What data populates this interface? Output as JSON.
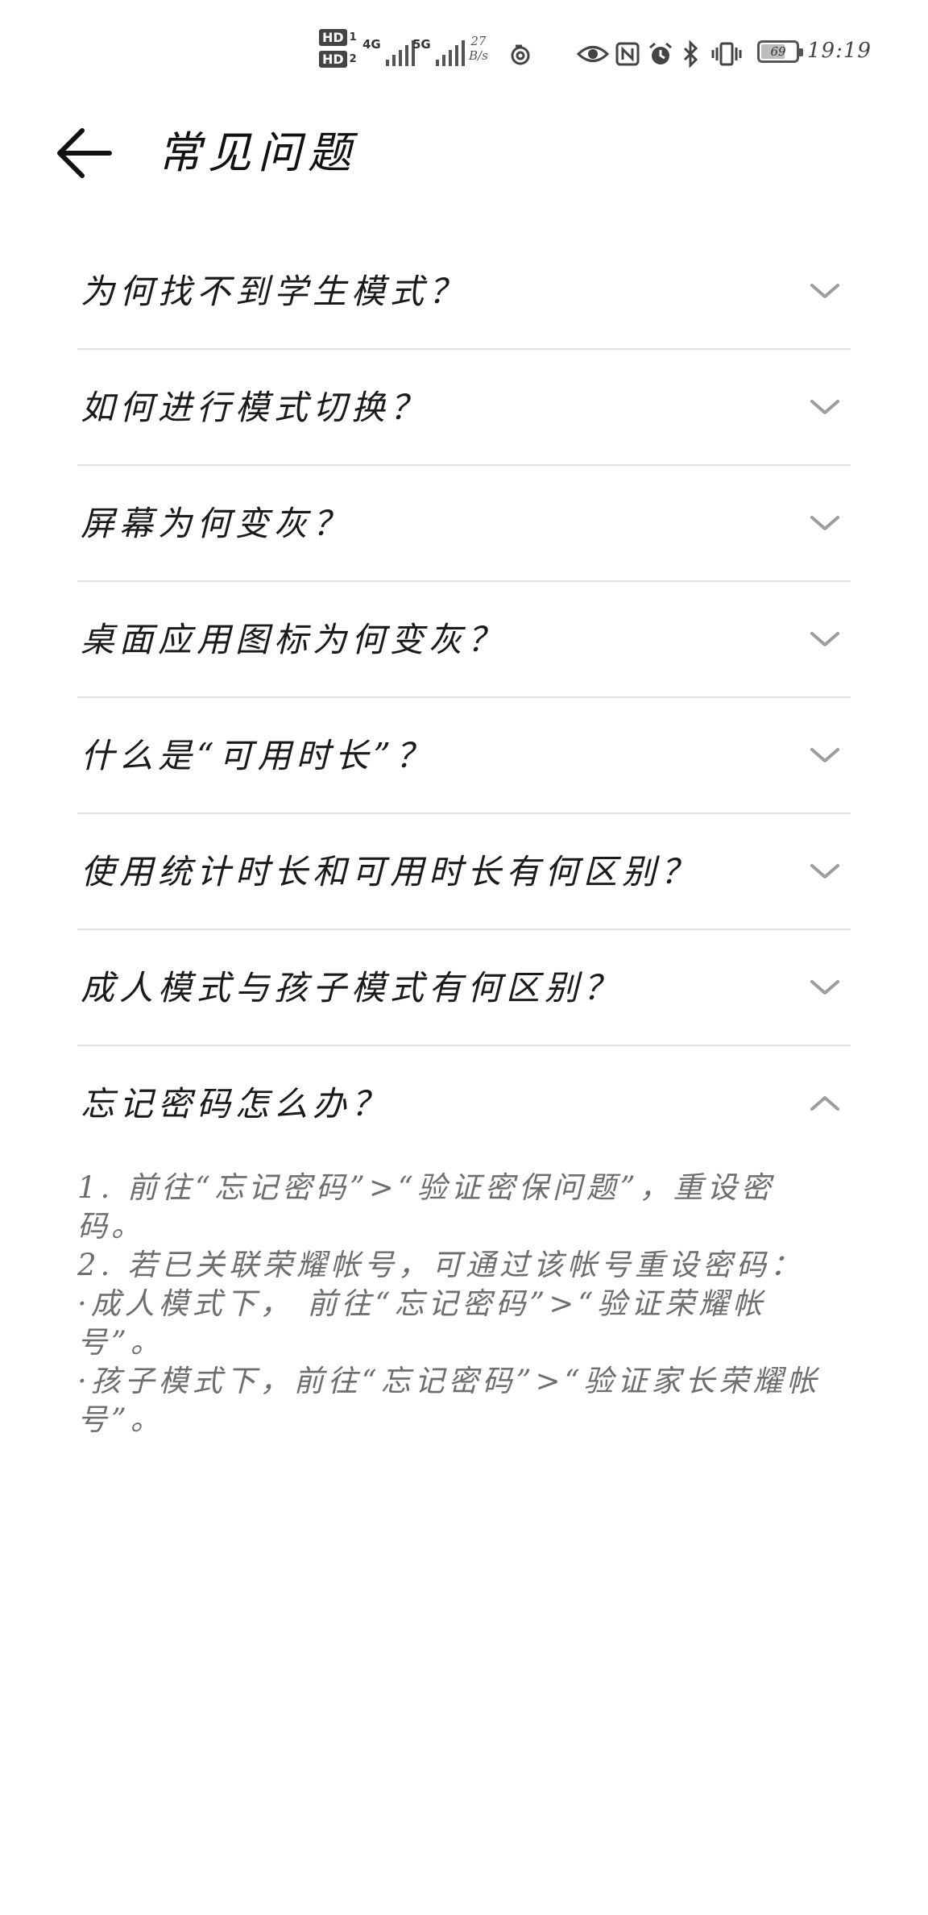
{
  "status_bar": {
    "sim1": "HD",
    "sim1_index": "1",
    "sim2": "HD",
    "sim2_index": "2",
    "network1": "4G",
    "network2": "5G",
    "speed_value": "27",
    "speed_unit": "B/s",
    "battery": "69",
    "time": "19:19",
    "icons": [
      "hotspot-icon",
      "eye-icon",
      "nfc-icon",
      "alarm-icon",
      "bluetooth-icon",
      "vibrate-icon",
      "battery-icon"
    ]
  },
  "header": {
    "title": "常见问题"
  },
  "faq": {
    "items": [
      {
        "question": "为何找不到学生模式？"
      },
      {
        "question": "如何进行模式切换？"
      },
      {
        "question": "屏幕为何变灰？"
      },
      {
        "question": "桌面应用图标为何变灰？"
      },
      {
        "question": "什么是“可用时长”？"
      },
      {
        "question": "使用统计时长和可用时长有何区别？"
      },
      {
        "question": "成人模式与孩子模式有何区别？"
      },
      {
        "question": "忘记密码怎么办？"
      }
    ],
    "expanded_answer": {
      "lines": [
        "1. 前往“忘记密码”>“验证密保问题”，重设密",
        "码。",
        "2. 若已关联荣耀帐号，可通过该帐号重设密码：",
        "·成人模式下， 前往“忘记密码”>“验证荣耀帐",
        "号”。",
        "·孩子模式下，前往“忘记密码”>“验证家长荣耀帐",
        "号”。"
      ]
    }
  },
  "colors": {
    "background": "#ffffff",
    "divider": "#e3e3e3",
    "question_text": "#1a1a1a",
    "answer_text": "#6e6e6e",
    "chevron": "#9e9e9e"
  }
}
